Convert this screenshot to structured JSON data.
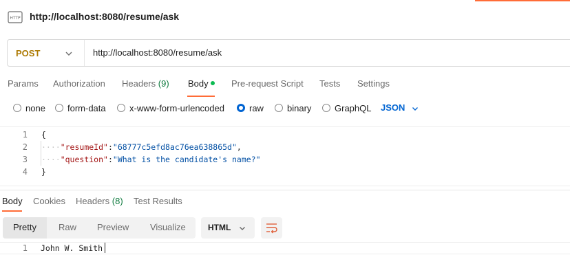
{
  "request": {
    "title": "http://localhost:8080/resume/ask",
    "icon": "http-icon",
    "method": "POST",
    "url": "http://localhost:8080/resume/ask"
  },
  "request_tabs": [
    {
      "label": "Params"
    },
    {
      "label": "Authorization"
    },
    {
      "label": "Headers",
      "count": "(9)"
    },
    {
      "label": "Body"
    },
    {
      "label": "Pre-request Script"
    },
    {
      "label": "Tests"
    },
    {
      "label": "Settings"
    }
  ],
  "body_types": [
    "none",
    "form-data",
    "x-www-form-urlencoded",
    "raw",
    "binary",
    "GraphQL"
  ],
  "body_type_selected": "raw",
  "raw_format": "JSON",
  "editor": {
    "line_numbers": [
      "1",
      "2",
      "3",
      "4"
    ],
    "lines": {
      "open": "{",
      "indent": "····",
      "key1": "\"resumeId\"",
      "sep1": ":",
      "val1": "\"68777c5efd8ac76ea638865d\"",
      "comma1": ",",
      "key2": "\"question\"",
      "sep2": ":",
      "val2": "\"What is the candidate's name?\"",
      "close": "}"
    }
  },
  "response_tabs": [
    {
      "label": "Body"
    },
    {
      "label": "Cookies"
    },
    {
      "label": "Headers",
      "count": "(8)"
    },
    {
      "label": "Test Results"
    }
  ],
  "view_modes": [
    "Pretty",
    "Raw",
    "Preview",
    "Visualize"
  ],
  "view_mode_selected": "Pretty",
  "response_format": "HTML",
  "response": {
    "line_number": "1",
    "text": "John W. Smith"
  },
  "colors": {
    "accent": "#ff6c37",
    "method_post": "#ad7a03",
    "link_blue": "#0265d2",
    "dot_green": "#0cbb52"
  }
}
